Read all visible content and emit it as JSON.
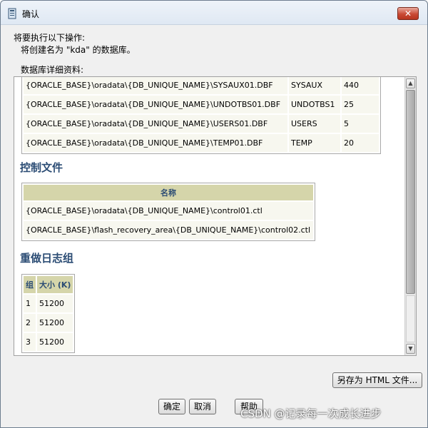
{
  "window": {
    "title": "确认",
    "close_label": "✕"
  },
  "intro": {
    "line1": "将要执行以下操作:",
    "line2": "将创建名为 \"kda\" 的数据库。"
  },
  "details_label": "数据库详细资料:",
  "tablespace_rows": [
    {
      "file": "{ORACLE_BASE}\\oradata\\{DB_UNIQUE_NAME}\\SYSAUX01.DBF",
      "name": "SYSAUX",
      "size": "440"
    },
    {
      "file": "{ORACLE_BASE}\\oradata\\{DB_UNIQUE_NAME}\\UNDOTBS01.DBF",
      "name": "UNDOTBS1",
      "size": "25"
    },
    {
      "file": "{ORACLE_BASE}\\oradata\\{DB_UNIQUE_NAME}\\USERS01.DBF",
      "name": "USERS",
      "size": "5"
    },
    {
      "file": "{ORACLE_BASE}\\oradata\\{DB_UNIQUE_NAME}\\TEMP01.DBF",
      "name": "TEMP",
      "size": "20"
    }
  ],
  "control_files": {
    "heading": "控制文件",
    "column": "名称",
    "rows": [
      "{ORACLE_BASE}\\oradata\\{DB_UNIQUE_NAME}\\control01.ctl",
      "{ORACLE_BASE}\\flash_recovery_area\\{DB_UNIQUE_NAME}\\control02.ctl"
    ]
  },
  "redo_logs": {
    "heading": "重做日志组",
    "col_group": "组",
    "col_size": "大小 (K)",
    "rows": [
      {
        "group": "1",
        "size": "51200"
      },
      {
        "group": "2",
        "size": "51200"
      },
      {
        "group": "3",
        "size": "51200"
      }
    ]
  },
  "buttons": {
    "save_html": "另存为 HTML 文件...",
    "ok": "确定",
    "cancel": "取消",
    "help": "帮助"
  },
  "watermark": "CSDN @记录每一次成长进步",
  "icons": {
    "title": "database-icon",
    "close": "close-icon",
    "scroll_up": "scroll-up-icon",
    "scroll_down": "scroll-down-icon"
  }
}
